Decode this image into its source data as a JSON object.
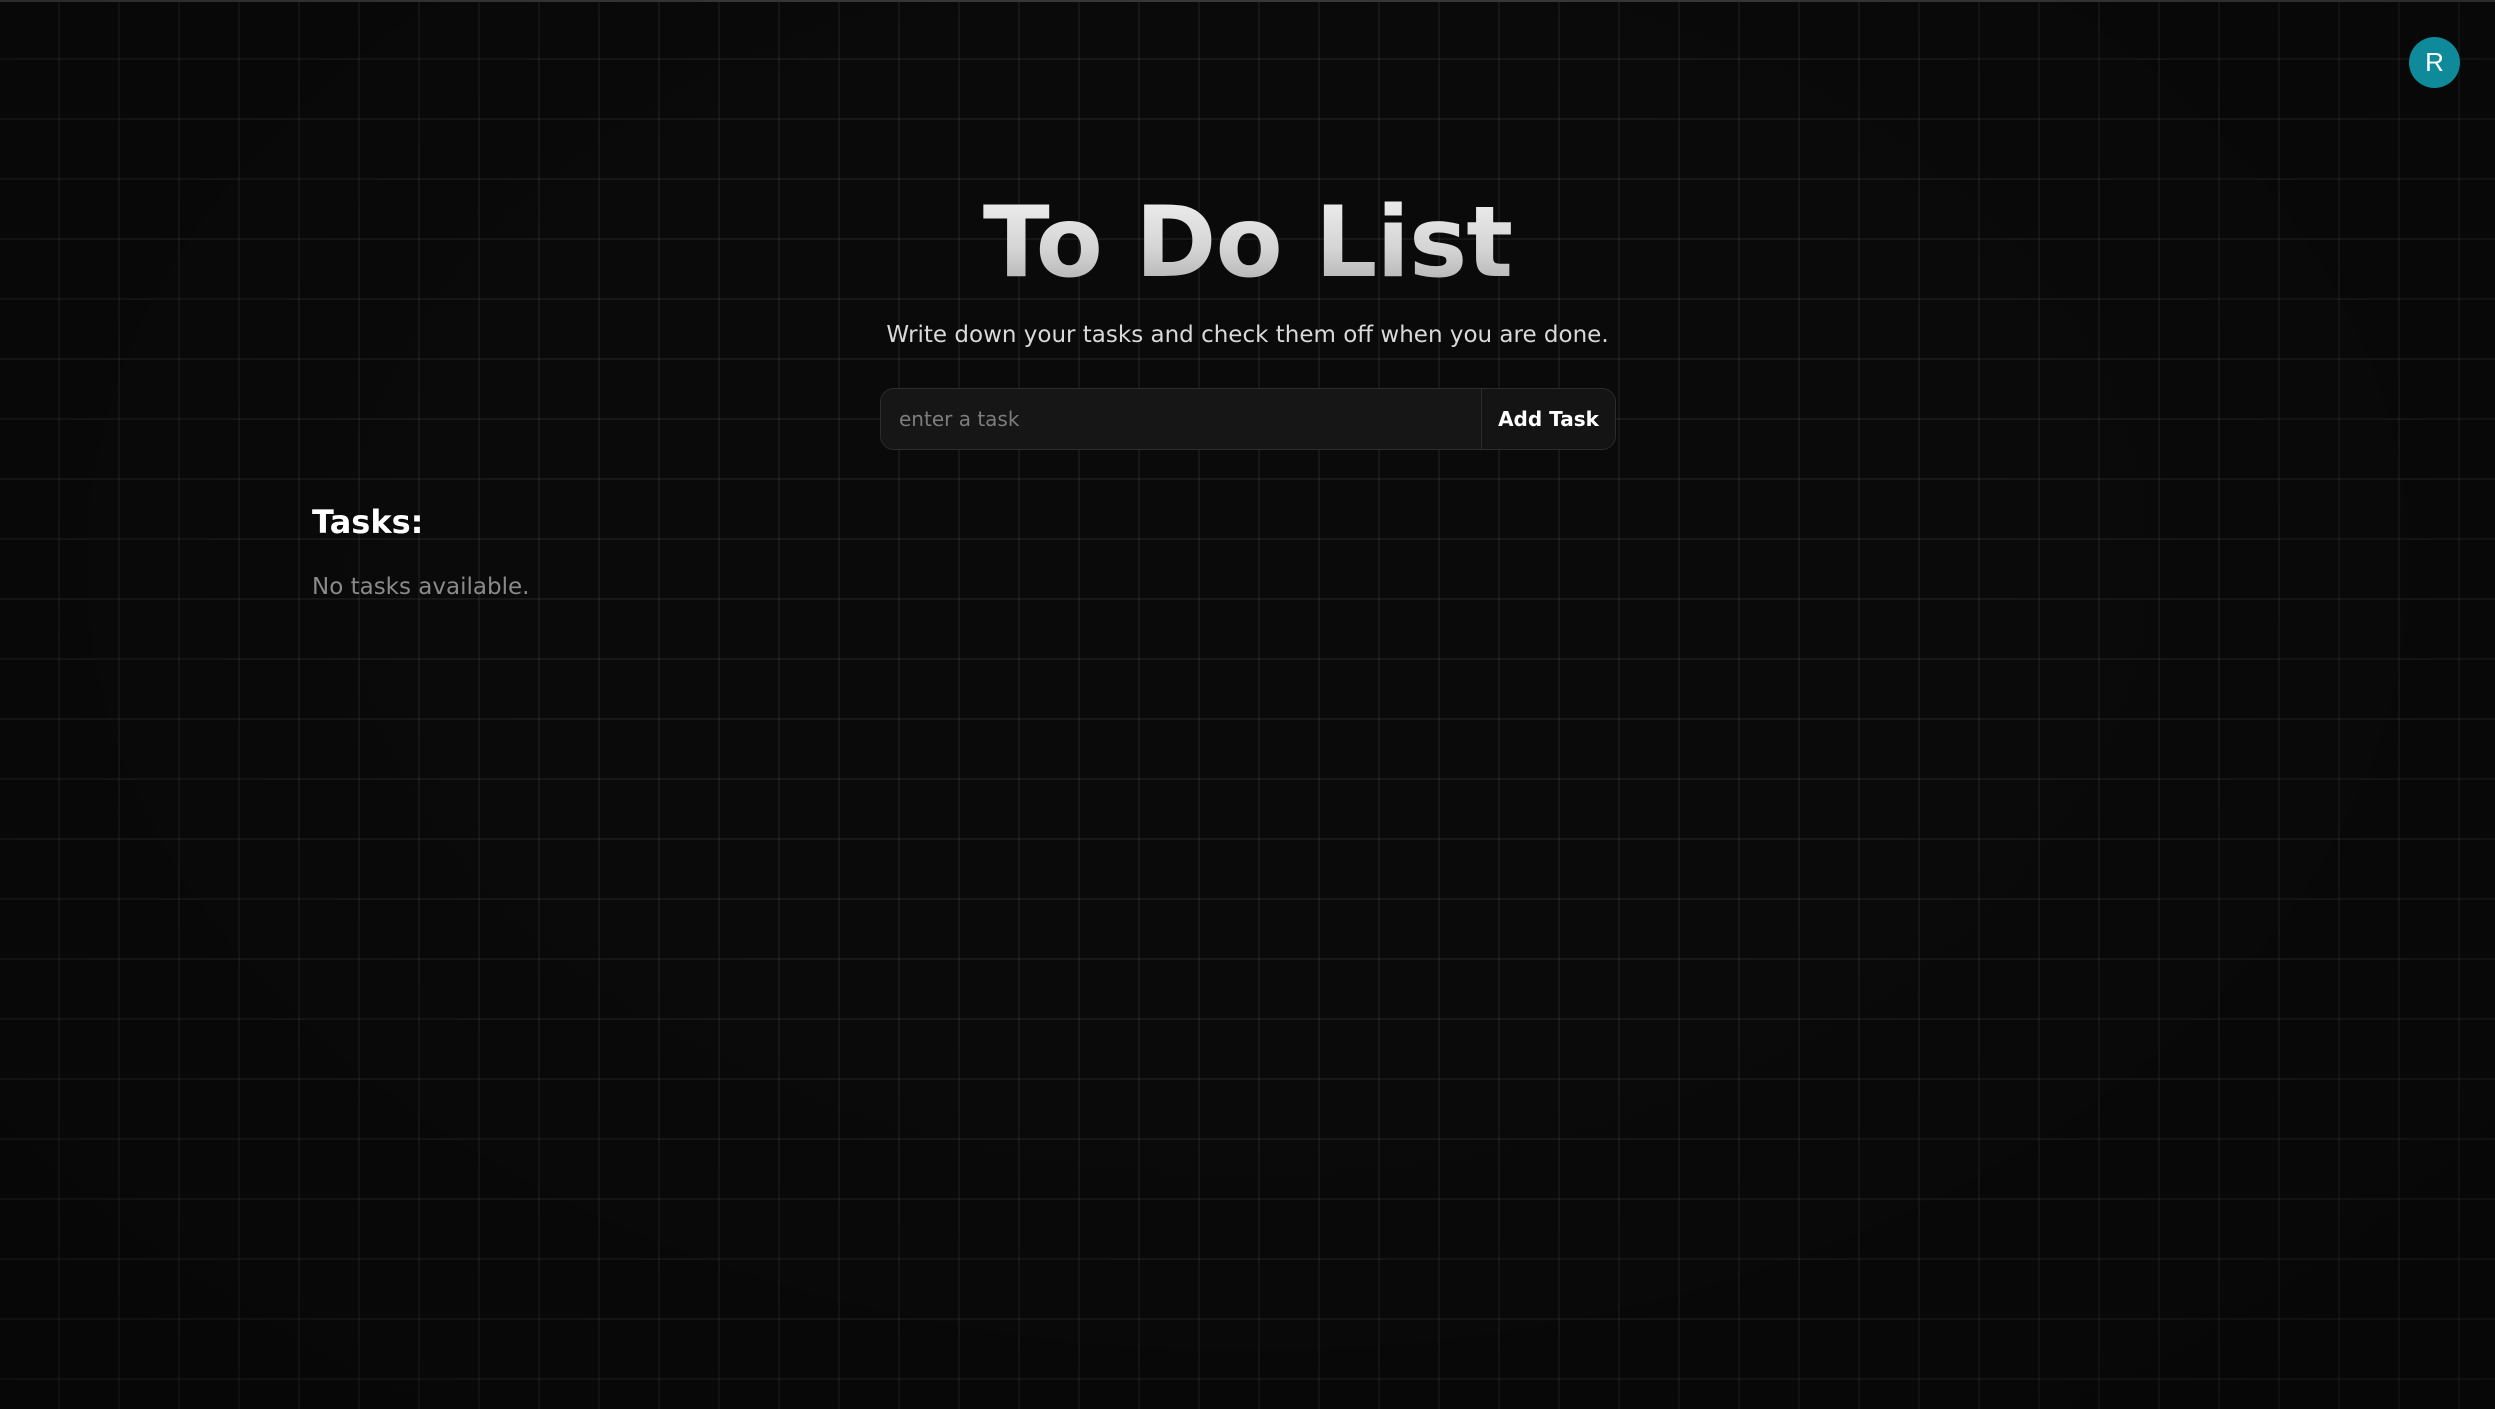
{
  "header": {
    "avatar_initial": "R",
    "avatar_color": "#0e8a9a"
  },
  "hero": {
    "title": "To Do List",
    "subtitle": "Write down your tasks and check them off when you are done."
  },
  "task_form": {
    "input_value": "",
    "input_placeholder": "enter a task",
    "add_button_label": "Add Task"
  },
  "tasks": {
    "heading": "Tasks:",
    "empty_message": "No tasks available.",
    "items": []
  },
  "theme": {
    "background": "#0a0a0a",
    "accent": "#0e8a9a"
  }
}
